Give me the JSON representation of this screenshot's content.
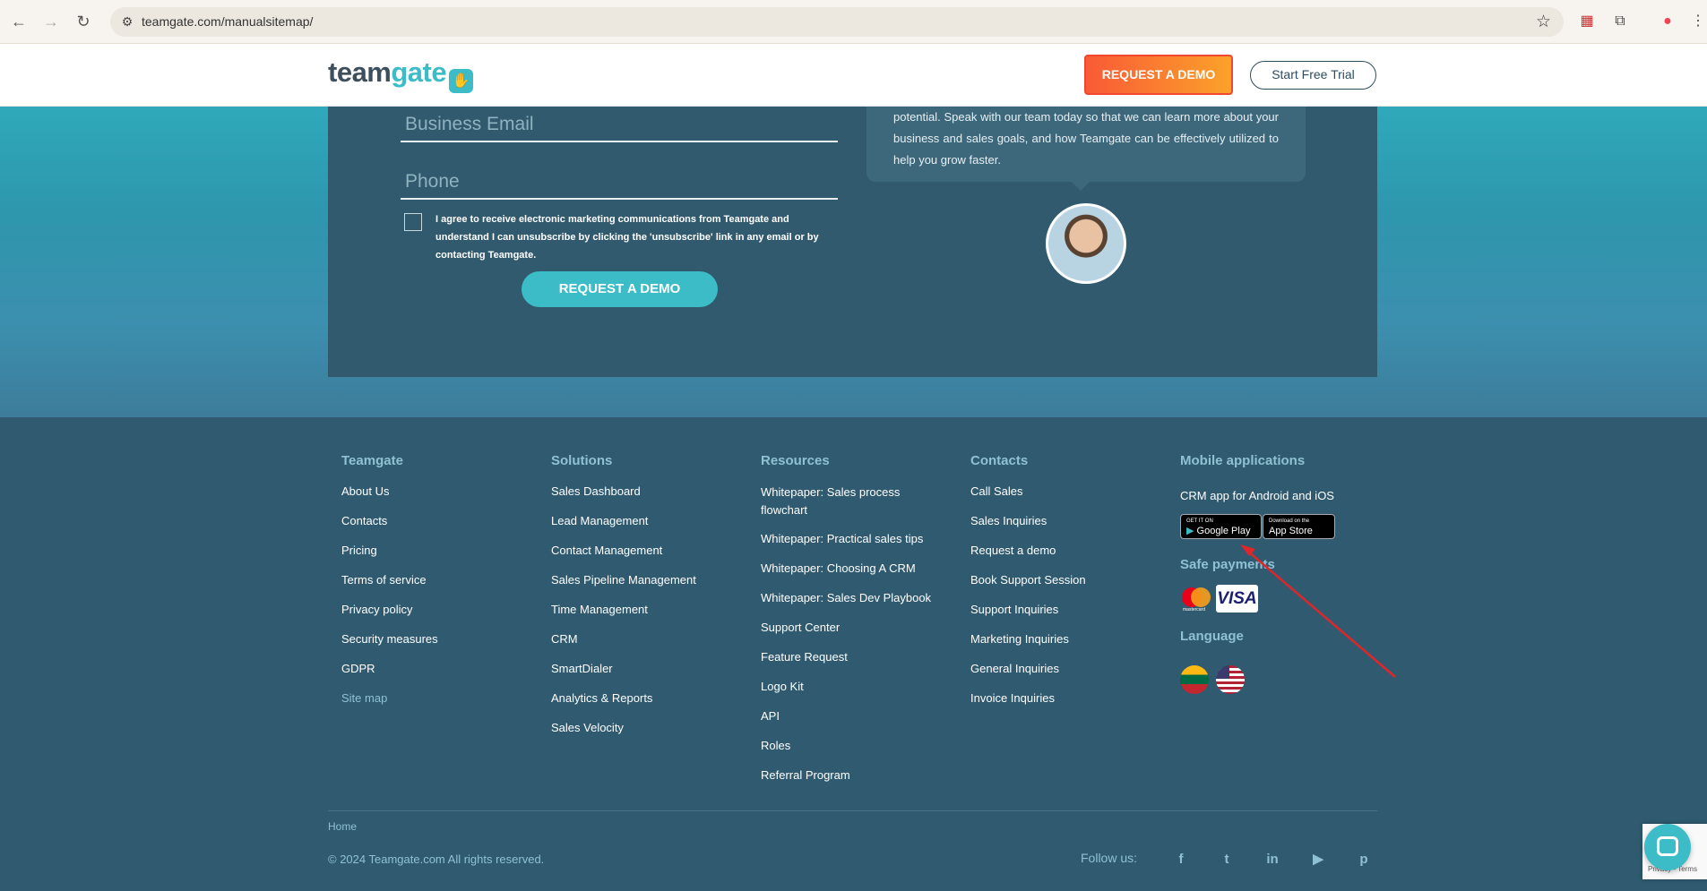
{
  "browser": {
    "url": "teamgate.com/manualsitemap/"
  },
  "header": {
    "logo_left": "team",
    "logo_right": "gate",
    "request_demo": "REQUEST A DEMO",
    "start_trial": "Start Free Trial"
  },
  "form": {
    "email_placeholder": "Business Email",
    "phone_placeholder": "Phone",
    "consent": "I agree to receive electronic marketing communications from Teamgate and understand I can unsubscribe by clicking the 'unsubscribe' link in any email or by contacting Teamgate.",
    "submit": "REQUEST A DEMO"
  },
  "speech": "potential. Speak with our team today so that we can learn more about your business and sales goals, and how Teamgate can be effectively utilized to help you grow faster.",
  "footer": {
    "teamgate": {
      "title": "Teamgate",
      "links": [
        "About Us",
        "Contacts",
        "Pricing",
        "Terms of service",
        "Privacy policy",
        "Security measures",
        "GDPR",
        "Site map"
      ]
    },
    "solutions": {
      "title": "Solutions",
      "links": [
        "Sales Dashboard",
        "Lead Management",
        "Contact Management",
        "Sales Pipeline Management",
        "Time Management",
        "CRM",
        "SmartDialer",
        "Analytics & Reports",
        "Sales Velocity"
      ]
    },
    "resources": {
      "title": "Resources",
      "links": [
        "Whitepaper: Sales process flowchart",
        "Whitepaper: Practical sales tips",
        "Whitepaper: Choosing A CRM",
        "Whitepaper: Sales Dev Playbook",
        "Support Center",
        "Feature Request",
        "Logo Kit",
        "API",
        "Roles",
        "Referral Program"
      ]
    },
    "contacts": {
      "title": "Contacts",
      "links": [
        "Call Sales",
        "Sales Inquiries",
        "Request a demo",
        "Book Support Session",
        "Support Inquiries",
        "Marketing Inquiries",
        "General Inquiries",
        "Invoice Inquiries"
      ]
    },
    "mobile": {
      "title": "Mobile applications",
      "subtitle": "CRM app for Android and iOS",
      "google_small": "GET IT ON",
      "google": "Google Play",
      "apple_small": "Download on the",
      "apple": "App Store",
      "payments_title": "Safe payments",
      "mastercard": "mastercard",
      "visa": "VISA",
      "language_title": "Language"
    },
    "home": "Home",
    "copyright": "© 2024 Teamgate.com All rights reserved.",
    "follow": "Follow us:",
    "social_icons": [
      "facebook-icon",
      "twitter-icon",
      "linkedin-icon",
      "youtube-icon",
      "pinterest-icon"
    ]
  },
  "recaptcha_terms": "Privacy - Terms",
  "colors": {
    "accent": "#3bbcc7",
    "cta_orange": "#f95a36",
    "footer_bg": "#2f5a6f",
    "arrow": "#e0262b"
  }
}
